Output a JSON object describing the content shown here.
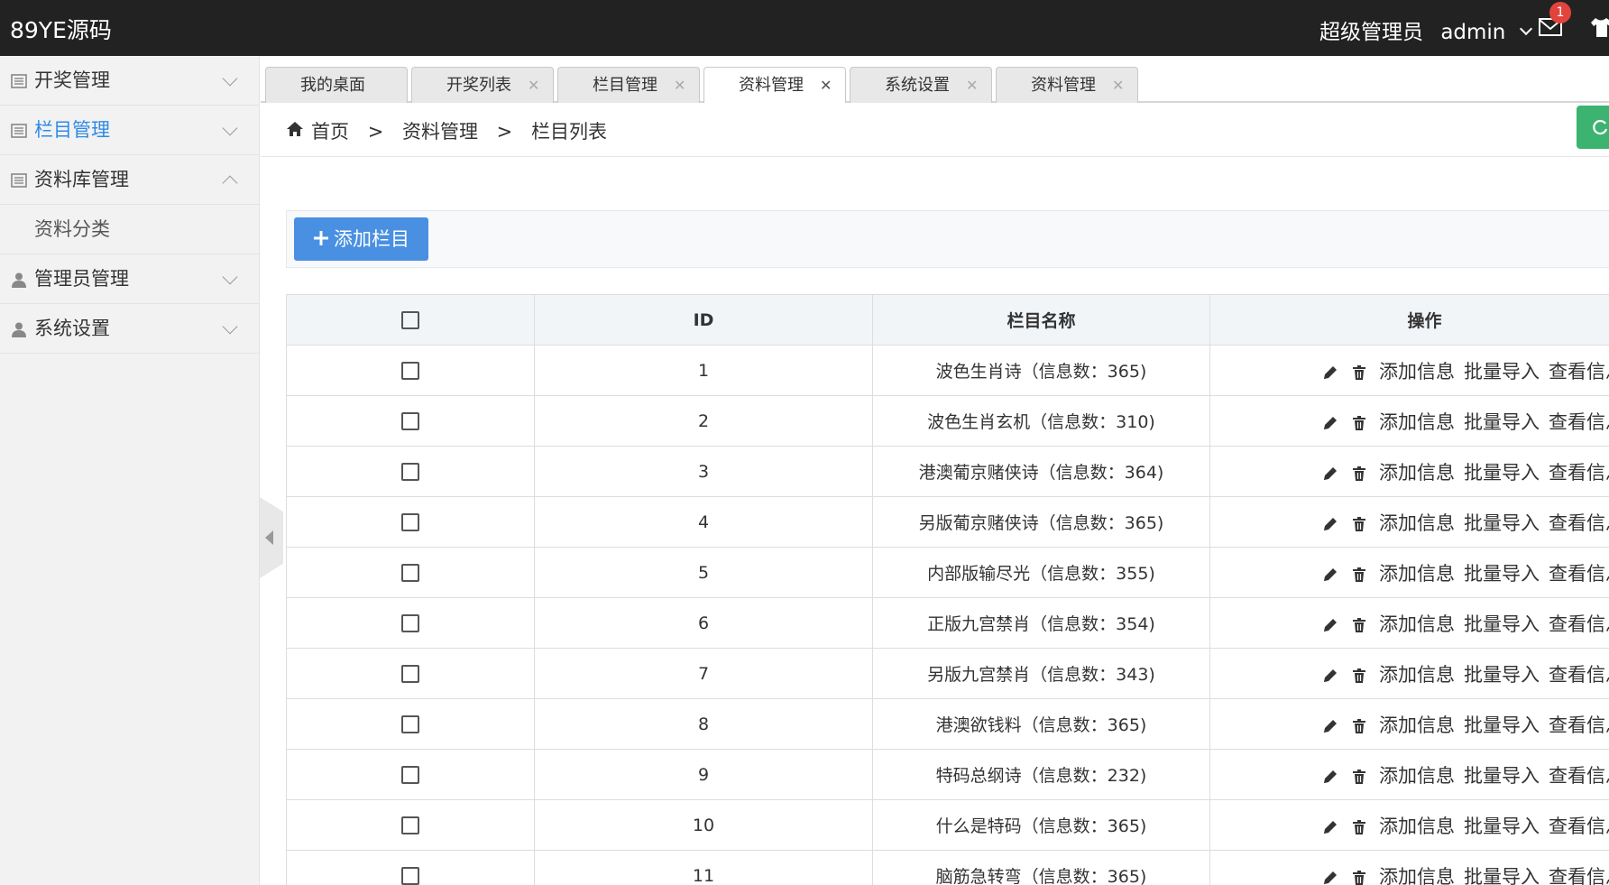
{
  "app": {
    "logo": "89YE源码"
  },
  "header": {
    "role": "超级管理员",
    "username": "admin",
    "mail_badge": "1"
  },
  "sidebar": {
    "items": [
      {
        "label": "开奖管理",
        "expanded": false,
        "active": false
      },
      {
        "label": "栏目管理",
        "expanded": false,
        "active": true
      },
      {
        "label": "资料库管理",
        "expanded": true,
        "active": false,
        "children": [
          "资料分类"
        ]
      },
      {
        "label": "管理员管理",
        "expanded": false,
        "active": false
      },
      {
        "label": "系统设置",
        "expanded": false,
        "active": false
      }
    ]
  },
  "tabs": [
    {
      "label": "我的桌面",
      "closable": false,
      "active": false
    },
    {
      "label": "开奖列表",
      "closable": true,
      "active": false
    },
    {
      "label": "栏目管理",
      "closable": true,
      "active": false
    },
    {
      "label": "资料管理",
      "closable": true,
      "active": true
    },
    {
      "label": "系统设置",
      "closable": true,
      "active": false
    },
    {
      "label": "资料管理",
      "closable": true,
      "active": false
    }
  ],
  "breadcrumb": {
    "home": "首页",
    "sep": ">",
    "level1": "资料管理",
    "level2": "栏目列表"
  },
  "toolbar": {
    "add_label": "添加栏目"
  },
  "table": {
    "headers": {
      "id": "ID",
      "name": "栏目名称",
      "ops": "操作"
    },
    "op_labels": {
      "add_info": "添加信息",
      "batch_import": "批量导入",
      "view_info": "查看信息"
    },
    "rows": [
      {
        "id": "1",
        "name": "波色生肖诗（信息数：365)"
      },
      {
        "id": "2",
        "name": "波色生肖玄机（信息数：310)"
      },
      {
        "id": "3",
        "name": "港澳葡京赌侠诗（信息数：364)"
      },
      {
        "id": "4",
        "name": "另版葡京赌侠诗（信息数：365)"
      },
      {
        "id": "5",
        "name": "内部版输尽光（信息数：355)"
      },
      {
        "id": "6",
        "name": "正版九宫禁肖（信息数：354)"
      },
      {
        "id": "7",
        "name": "另版九宫禁肖（信息数：343)"
      },
      {
        "id": "8",
        "name": "港澳欲钱料（信息数：365)"
      },
      {
        "id": "9",
        "name": "特码总纲诗（信息数：232)"
      },
      {
        "id": "10",
        "name": "什么是特码（信息数：365)"
      },
      {
        "id": "11",
        "name": "脑筋急转弯（信息数：365)"
      }
    ]
  },
  "colors": {
    "header_bg": "#222222",
    "accent": "#2e8ae6",
    "button": "#4a90e2",
    "badge": "#e3433c",
    "refresh": "#3cb371"
  }
}
